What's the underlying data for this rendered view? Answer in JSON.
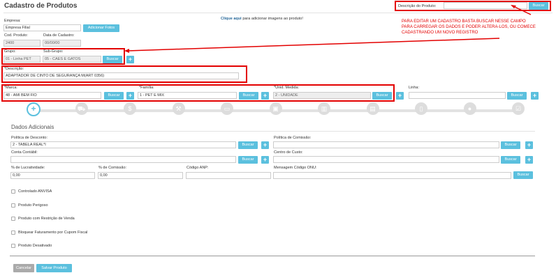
{
  "page": {
    "title": "Cadastro de Produtos",
    "image_link": "Clique aqui",
    "image_link_suffix": "para adicionar imagens ao produto!"
  },
  "search": {
    "label": "Descrição do Produto:",
    "value": "",
    "button": "Buscar"
  },
  "annotation": {
    "lines": [
      "PARA EDITAR UM CADASTRO BASTA BUSCAR NESSE CAMPO",
      "PARA CARREGAR OS DADOS E PODER ALTERA-LOS, OU COMECE",
      "CADASTRANDO UM NOVO REGISTRO"
    ],
    "color": "#e30000"
  },
  "form": {
    "empresa": {
      "label": "Empresa:",
      "value": "Empresa Filial",
      "button": "Adicionar Fotos"
    },
    "cod_produto": {
      "label": "Cod. Produto:",
      "value": "2400"
    },
    "data_cadastro": {
      "label": "Data de Cadastro:",
      "value": "00/00/00"
    },
    "grupo": {
      "label": "Grupo:",
      "value": "01 - Linha PET"
    },
    "sub_grupo": {
      "label": "Sub-Grupo:",
      "value": "05 - CAES E GATOS",
      "button": "Buscar"
    },
    "descricao": {
      "label": "*Descrição:",
      "value": "ADAPTADOR DE CINTO DE SEGURANÇA M(ART 0356)"
    },
    "marca": {
      "label": "*Marca:",
      "value": "48 - AMI BEM FIO",
      "button": "Buscar"
    },
    "familia": {
      "label": "*Família:",
      "value": "1 - PET E MIX",
      "button": "Buscar"
    },
    "unid_medida": {
      "label": "*Unid. Medida:",
      "value": "2 - UNIDADE",
      "button": "Buscar"
    },
    "linha": {
      "label": "Linha:",
      "value": "",
      "button": "Buscar"
    }
  },
  "tabs": [
    {
      "icon": "plus-icon",
      "glyph": "+"
    },
    {
      "icon": "truck-icon",
      "glyph": "⛟"
    },
    {
      "icon": "dollar-icon",
      "glyph": "$"
    },
    {
      "icon": "wrench-icon",
      "glyph": "⚒"
    },
    {
      "icon": "money-icon",
      "glyph": "▭"
    },
    {
      "icon": "box-icon",
      "glyph": "▣"
    },
    {
      "icon": "barcode-icon",
      "glyph": "▥"
    },
    {
      "icon": "book-icon",
      "glyph": "▤"
    },
    {
      "icon": "document-icon",
      "glyph": "▯"
    },
    {
      "icon": "map-marker-icon",
      "glyph": "●"
    },
    {
      "icon": "checklist-icon",
      "glyph": "☑"
    }
  ],
  "dados": {
    "title": "Dados Adicionais",
    "politica_desconto": {
      "label": "Política de Desconto:",
      "value": "2 - TABELA REAL*I",
      "button": "Buscar"
    },
    "politica_comissao": {
      "label": "Política de Comissão:",
      "value": "",
      "button": "Buscar"
    },
    "conta_contabil": {
      "label": "Conta Contábil:",
      "value": "",
      "button": "Buscar"
    },
    "centro_custo": {
      "label": "Centro de Custo:",
      "value": "",
      "button": "Buscar"
    },
    "lucratividade": {
      "label": "% de Lucratividade:",
      "value": "0,00"
    },
    "comissao": {
      "label": "% de Comissão:",
      "value": "0,00"
    },
    "codigo_anp": {
      "label": "Código ANP:",
      "value": ""
    },
    "mensagem_onu": {
      "label": "Mensagem Código ONU:",
      "value": "",
      "button": "Buscar"
    }
  },
  "checkboxes": [
    "Controlado ANVISA",
    "Produto Perigoso",
    "Produto com Restrição de Venda",
    "Bloquear Faturamento por Cupom Fiscal",
    "Produto Desativado"
  ],
  "actions": {
    "cancel": "Cancelar",
    "save": "Salvar Produto"
  }
}
